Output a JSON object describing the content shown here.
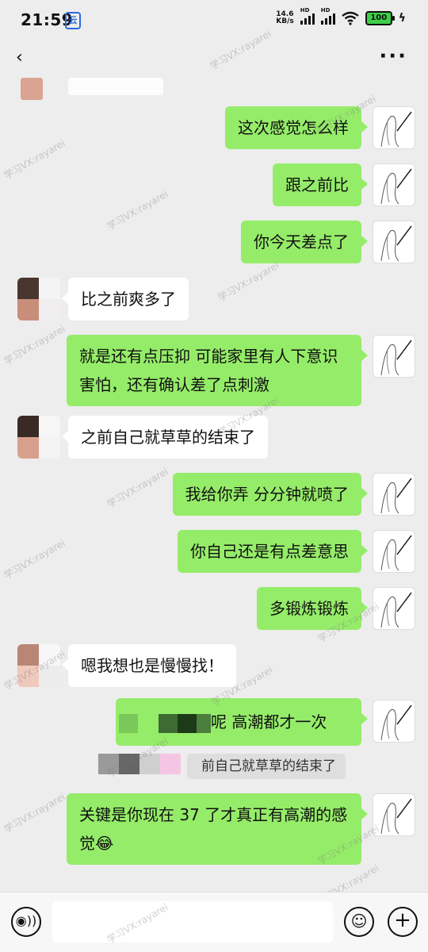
{
  "status_bar": {
    "time": "21:59",
    "app_badge": "云",
    "net_speed_value": "14.6",
    "net_speed_unit": "KB/s",
    "signal1_label": "HD",
    "signal2_label": "HD",
    "battery": "100"
  },
  "nav": {
    "back_glyph": "‹",
    "more_glyph": "···"
  },
  "messages": [
    {
      "from": "me",
      "text": "这次感觉怎么样"
    },
    {
      "from": "me",
      "text": "跟之前比"
    },
    {
      "from": "me",
      "text": "你今天差点了"
    },
    {
      "from": "other",
      "text": "比之前爽多了"
    },
    {
      "from": "me",
      "text": "就是还有点压抑 可能家里有人下意识害怕，还有确认差了点刺激"
    },
    {
      "from": "other",
      "text": "之前自己就草草的结束了"
    },
    {
      "from": "me",
      "text": "我给你弄 分分钟就喷了"
    },
    {
      "from": "me",
      "text": "你自己还是有点差意思"
    },
    {
      "from": "me",
      "text": "多锻炼锻炼"
    },
    {
      "from": "other",
      "text": "嗯我想也是慢慢找！"
    },
    {
      "from": "me",
      "text": "呢 高潮都才一次"
    },
    {
      "from": "me",
      "text": "关键是你现在 37 了才真正有高潮的感觉😂"
    }
  ],
  "quote": {
    "text": "前自己就草草的结束了"
  },
  "watermark": "学习VX:rayarei",
  "input_bar": {
    "placeholder": "",
    "voice_icon": "◉))",
    "emoji_icon": "☺",
    "plus_icon": "+"
  },
  "colors": {
    "my_bubble": "#95ec69",
    "other_bubble": "#ffffff",
    "background": "#ededed"
  }
}
